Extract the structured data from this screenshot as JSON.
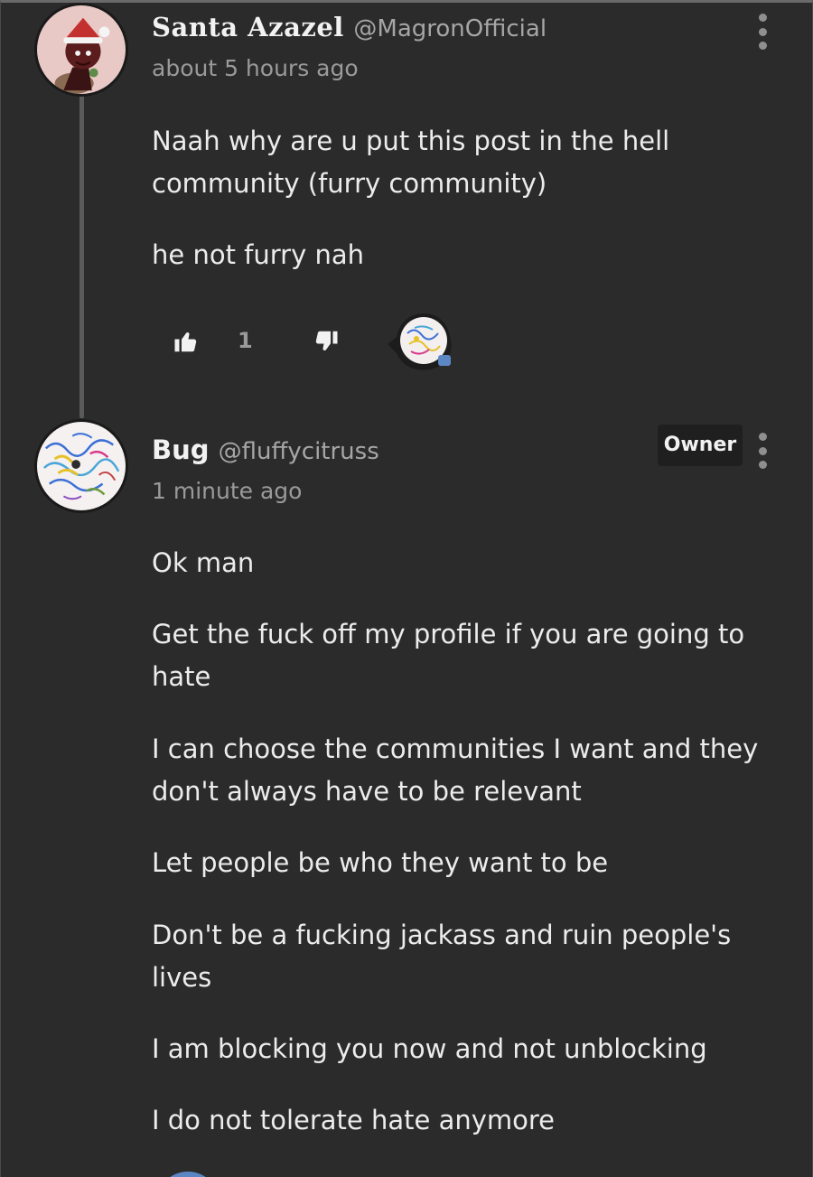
{
  "comments": [
    {
      "author": "Santa Azazel",
      "handle": "@MagronOfficial",
      "time": "about 5 hours ago",
      "paragraphs": [
        "Naah why are u put this post in the hell community (furry community)",
        "he not furry nah"
      ],
      "likes": "1",
      "icons": {
        "like": "thumbs-up-icon",
        "dislike": "thumbs-down-icon",
        "reply": "reply-bubble-icon",
        "menu": "kebab-menu-icon"
      }
    },
    {
      "author": "Bug",
      "handle": "@fluffycitruss",
      "time": "1 minute ago",
      "badge": "Owner",
      "paragraphs": [
        "Ok man",
        "Get the fuck off my profile if you are going to hate",
        "I can choose the communities I want and they don't always have to be relevant",
        "Let people be who they want to be",
        "Don't be a fucking jackass and ruin people's lives",
        "I am blocking you now and not unblocking",
        "I do not tolerate hate anymore"
      ]
    }
  ],
  "colors": {
    "background": "#2b2b2b",
    "accent": "#5b87c4",
    "muted_text": "#9a9a9a"
  }
}
